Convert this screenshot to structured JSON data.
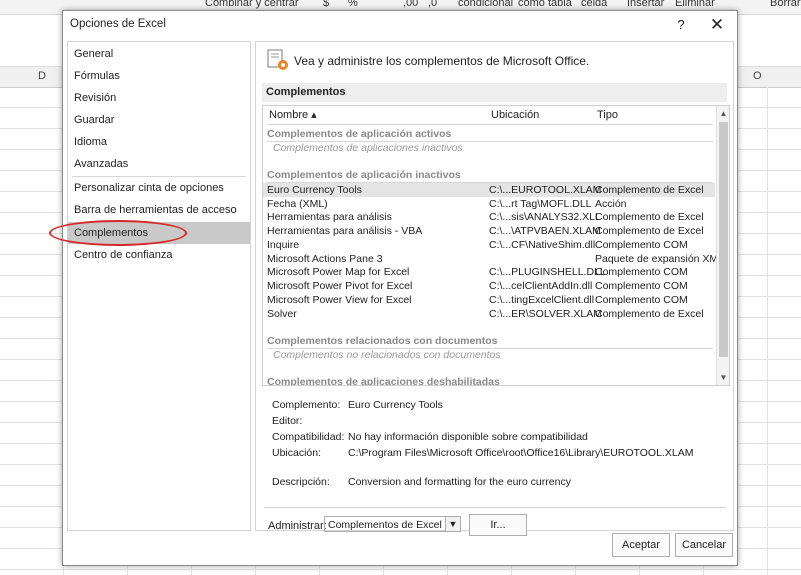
{
  "excel": {
    "ribbon": [
      "Combinar y centrar",
      "$",
      "%",
      ",00",
      ",0",
      "condicional",
      "como tabla",
      "celda",
      "Insertar",
      "Eliminar",
      "Borrar"
    ],
    "columns": {
      "left": "D",
      "right": "O"
    }
  },
  "dialog": {
    "title": "Opciones de Excel",
    "help": "?",
    "close": "✕",
    "nav": [
      "General",
      "Fórmulas",
      "Revisión",
      "Guardar",
      "Idioma",
      "Avanzadas",
      "Personalizar cinta de opciones",
      "Barra de herramientas de acceso rápido",
      "Complementos",
      "Centro de confianza"
    ],
    "nav_active": "Complementos",
    "header": "Vea y administre los complementos de Microsoft Office.",
    "section_title": "Complementos",
    "table": {
      "col_name": "Nombre ▴",
      "col_location": "Ubicación",
      "col_type": "Tipo",
      "groups": {
        "active_title": "Complementos de aplicación activos",
        "active_empty": "Complementos de aplicaciones inactivos",
        "inactive_title": "Complementos de aplicación inactivos",
        "document_title": "Complementos relacionados con documentos",
        "document_empty": "Complementos no relacionados con documentos",
        "disabled_title": "Complementos de aplicaciones deshabilitadas"
      },
      "inactive_rows": [
        {
          "name": "Euro Currency Tools",
          "location": "C:\\...EUROTOOL.XLAM",
          "type": "Complemento de Excel"
        },
        {
          "name": "Fecha (XML)",
          "location": "C:\\...rt Tag\\MOFL.DLL",
          "type": "Acción"
        },
        {
          "name": "Herramientas para análisis",
          "location": "C:\\...sis\\ANALYS32.XLL",
          "type": "Complemento de Excel"
        },
        {
          "name": "Herramientas para análisis - VBA",
          "location": "C:\\...\\ATPVBAEN.XLAM",
          "type": "Complemento de Excel"
        },
        {
          "name": "Inquire",
          "location": "C:\\...CF\\NativeShim.dll",
          "type": "Complemento COM"
        },
        {
          "name": "Microsoft Actions Pane 3",
          "location": "",
          "type": "Paquete de expansión XML"
        },
        {
          "name": "Microsoft Power Map for Excel",
          "location": "C:\\...PLUGINSHELL.DLL",
          "type": "Complemento COM"
        },
        {
          "name": "Microsoft Power Pivot for Excel",
          "location": "C:\\...celClientAddIn.dll",
          "type": "Complemento COM"
        },
        {
          "name": "Microsoft Power View for Excel",
          "location": "C:\\...tingExcelClient.dll",
          "type": "Complemento COM"
        },
        {
          "name": "Solver",
          "location": "C:\\...ER\\SOLVER.XLAM",
          "type": "Complemento de Excel"
        }
      ]
    },
    "details": {
      "complemento_label": "Complemento:",
      "complemento_value": "Euro Currency Tools",
      "editor_label": "Editor:",
      "editor_value": "",
      "compat_label": "Compatibilidad:",
      "compat_value": "No hay información disponible sobre compatibilidad",
      "ubicacion_label": "Ubicación:",
      "ubicacion_value": "C:\\Program Files\\Microsoft Office\\root\\Office16\\Library\\EUROTOOL.XLAM",
      "descripcion_label": "Descripción:",
      "descripcion_value": "Conversion and formatting for the euro currency"
    },
    "manage_label": "Administrar:",
    "manage_value": "Complementos de Excel",
    "go": "Ir...",
    "ok": "Aceptar",
    "cancel": "Cancelar"
  }
}
